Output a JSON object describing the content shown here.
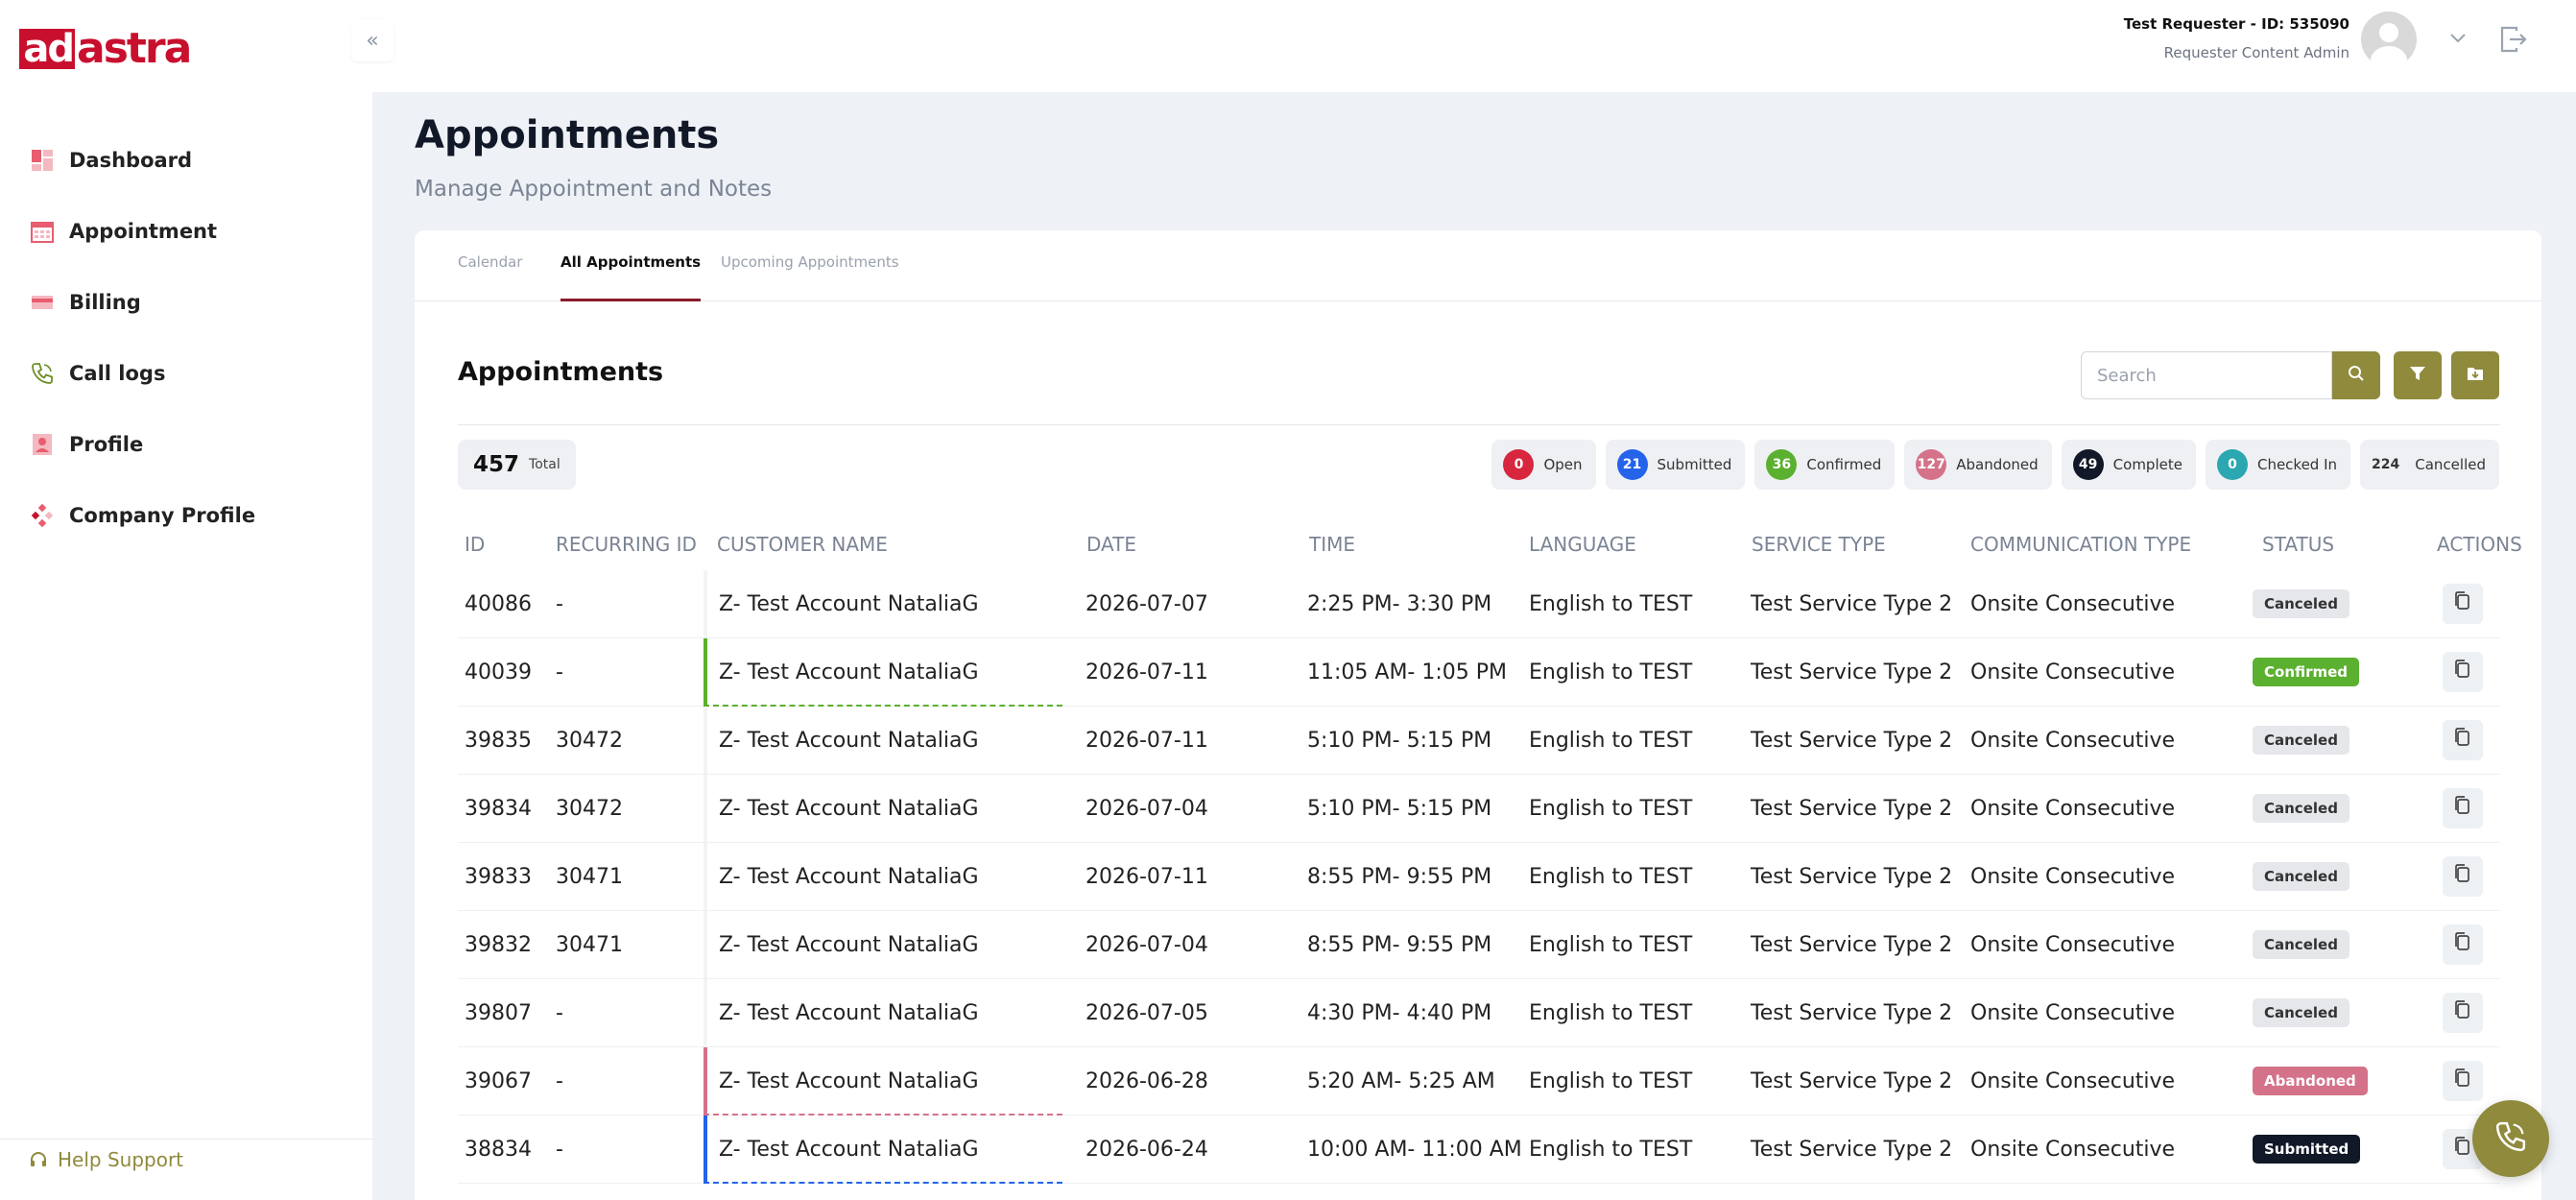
{
  "brand": {
    "logo_mark": "ad",
    "logo_text": "astra",
    "accent": "#8f8a3c",
    "brand_red": "#c8102e"
  },
  "sidebar": {
    "items": [
      {
        "label": "Dashboard",
        "icon": "dashboard-icon"
      },
      {
        "label": "Appointment",
        "icon": "calendar-icon"
      },
      {
        "label": "Billing",
        "icon": "billing-icon"
      },
      {
        "label": "Call logs",
        "icon": "phone-icon"
      },
      {
        "label": "Profile",
        "icon": "profile-icon"
      },
      {
        "label": "Company Profile",
        "icon": "company-icon"
      }
    ],
    "help_label": "Help Support"
  },
  "header": {
    "user_name": "Test Requester - ID: 535090",
    "user_role": "Requester Content Admin"
  },
  "page": {
    "title": "Appointments",
    "subtitle": "Manage Appointment and Notes"
  },
  "tabs": [
    {
      "label": "Calendar",
      "active": false
    },
    {
      "label": "All Appointments",
      "active": true
    },
    {
      "label": "Upcoming Appointments",
      "active": false
    }
  ],
  "section": {
    "title": "Appointments",
    "search_placeholder": "Search",
    "total_count": "457",
    "total_label": "Total"
  },
  "status_counts": [
    {
      "count": "0",
      "label": "Open",
      "color": "#d7263d"
    },
    {
      "count": "21",
      "label": "Submitted",
      "color": "#2563eb"
    },
    {
      "count": "36",
      "label": "Confirmed",
      "color": "#5bb02f"
    },
    {
      "count": "127",
      "label": "Abandoned",
      "color": "#d4728a"
    },
    {
      "count": "49",
      "label": "Complete",
      "color": "#111827"
    },
    {
      "count": "0",
      "label": "Checked In",
      "color": "#2aa7b0"
    },
    {
      "count": "224",
      "label": "Cancelled",
      "color": ""
    }
  ],
  "table": {
    "columns": [
      "ID",
      "RECURRING ID",
      "CUSTOMER NAME",
      "DATE",
      "TIME",
      "LANGUAGE",
      "SERVICE TYPE",
      "COMMUNICATION TYPE",
      "STATUS",
      "ACTIONS"
    ],
    "rows": [
      {
        "id": "40086",
        "recurring_id": "-",
        "customer": "Z- Test Account NataliaG",
        "date": "2026-07-07",
        "time": "2:25 PM- 3:30 PM",
        "language": "English to TEST",
        "service": "Test Service Type 2",
        "communication": "Onsite Consecutive",
        "status": "Canceled",
        "status_color": "#e5e7eb",
        "status_text_color": "#333333",
        "marker_color": ""
      },
      {
        "id": "40039",
        "recurring_id": "-",
        "customer": "Z- Test Account NataliaG",
        "date": "2026-07-11",
        "time": "11:05 AM- 1:05 PM",
        "language": "English to TEST",
        "service": "Test Service Type 2",
        "communication": "Onsite Consecutive",
        "status": "Confirmed",
        "status_color": "#5bb02f",
        "status_text_color": "#ffffff",
        "marker_color": "#5bb02f"
      },
      {
        "id": "39835",
        "recurring_id": "30472",
        "customer": "Z- Test Account NataliaG",
        "date": "2026-07-11",
        "time": "5:10 PM- 5:15 PM",
        "language": "English to TEST",
        "service": "Test Service Type 2",
        "communication": "Onsite Consecutive",
        "status": "Canceled",
        "status_color": "#e5e7eb",
        "status_text_color": "#333333",
        "marker_color": ""
      },
      {
        "id": "39834",
        "recurring_id": "30472",
        "customer": "Z- Test Account NataliaG",
        "date": "2026-07-04",
        "time": "5:10 PM- 5:15 PM",
        "language": "English to TEST",
        "service": "Test Service Type 2",
        "communication": "Onsite Consecutive",
        "status": "Canceled",
        "status_color": "#e5e7eb",
        "status_text_color": "#333333",
        "marker_color": ""
      },
      {
        "id": "39833",
        "recurring_id": "30471",
        "customer": "Z- Test Account NataliaG",
        "date": "2026-07-11",
        "time": "8:55 PM- 9:55 PM",
        "language": "English to TEST",
        "service": "Test Service Type 2",
        "communication": "Onsite Consecutive",
        "status": "Canceled",
        "status_color": "#e5e7eb",
        "status_text_color": "#333333",
        "marker_color": ""
      },
      {
        "id": "39832",
        "recurring_id": "30471",
        "customer": "Z- Test Account NataliaG",
        "date": "2026-07-04",
        "time": "8:55 PM- 9:55 PM",
        "language": "English to TEST",
        "service": "Test Service Type 2",
        "communication": "Onsite Consecutive",
        "status": "Canceled",
        "status_color": "#e5e7eb",
        "status_text_color": "#333333",
        "marker_color": ""
      },
      {
        "id": "39807",
        "recurring_id": "-",
        "customer": "Z- Test Account NataliaG",
        "date": "2026-07-05",
        "time": "4:30 PM- 4:40 PM",
        "language": "English to TEST",
        "service": "Test Service Type 2",
        "communication": "Onsite Consecutive",
        "status": "Canceled",
        "status_color": "#e5e7eb",
        "status_text_color": "#333333",
        "marker_color": ""
      },
      {
        "id": "39067",
        "recurring_id": "-",
        "customer": "Z- Test Account NataliaG",
        "date": "2026-06-28",
        "time": "5:20 AM- 5:25 AM",
        "language": "English to TEST",
        "service": "Test Service Type 2",
        "communication": "Onsite Consecutive",
        "status": "Abandoned",
        "status_color": "#d4728a",
        "status_text_color": "#ffffff",
        "marker_color": "#d4728a"
      },
      {
        "id": "38834",
        "recurring_id": "-",
        "customer": "Z- Test Account NataliaG",
        "date": "2026-06-24",
        "time": "10:00 AM- 11:00 AM",
        "language": "English to TEST",
        "service": "Test Service Type 2",
        "communication": "Onsite Consecutive",
        "status": "Submitted",
        "status_color": "#111827",
        "status_text_color": "#ffffff",
        "marker_color": "#2563eb"
      }
    ]
  }
}
